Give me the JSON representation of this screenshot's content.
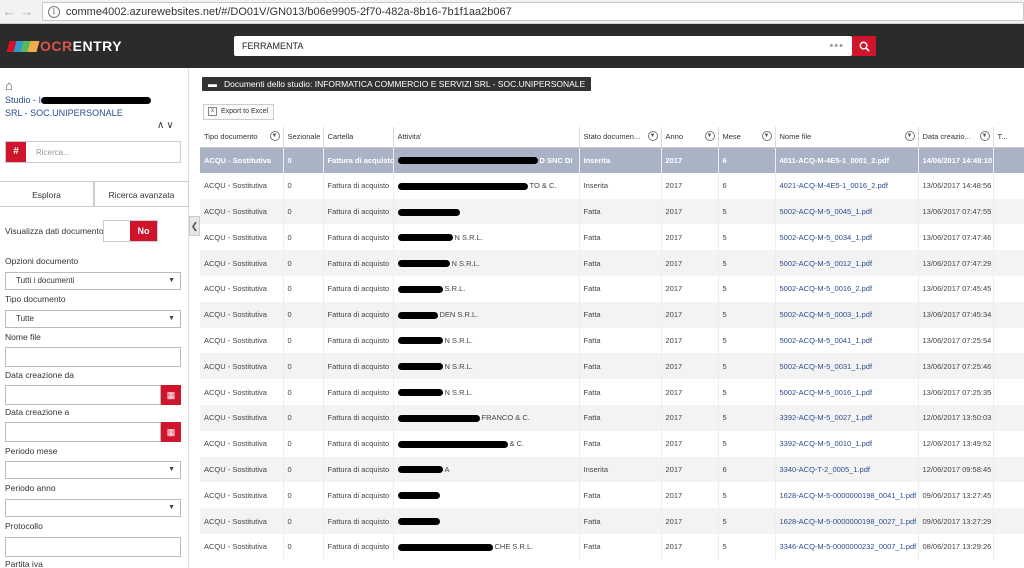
{
  "browser": {
    "url": "comme4002.azurewebsites.net/#/DO01V/GN013/b06e9905-2f70-482a-8b16-7b1f1aa2b067",
    "back": "←",
    "forward": "→"
  },
  "header": {
    "logo_prefix": "OCR",
    "logo_suffix": "ENTRY",
    "search_value": "FERRAMENTA",
    "search_dots": "•••",
    "logo_colors": [
      "#d0142b",
      "#2e9ad0",
      "#5cb85c",
      "#f0ad4e"
    ]
  },
  "sidebar": {
    "studio_prefix": "Studio - I",
    "studio_line2": "SRL - SOC.UNIPERSONALE",
    "search_hash": "#",
    "search_placeholder": "Ricerca...",
    "tabs": [
      "Esplora",
      "Ricerca avanzata"
    ],
    "visualizza_label": "Visualizza dati documento",
    "toggle_value": "No",
    "opzioni_label": "Opzioni documento",
    "opzioni_value": "Tutti i documenti",
    "tipo_label": "Tipo documento",
    "tipo_value": "Tutte",
    "nome_file_label": "Nome file",
    "data_da_label": "Data creazione da",
    "data_a_label": "Data creazione a",
    "periodo_mese_label": "Periodo mese",
    "periodo_anno_label": "Periodo anno",
    "protocollo_label": "Protocollo",
    "partita_label": "Partita iva"
  },
  "main": {
    "title": "Documenti dello studio: INFORMATICA COMMERCIO E SERVIZI SRL - SOC.UNIPERSONALE",
    "export_label": "Export to Excel",
    "columns": [
      "Tipo documento",
      "Sezionale",
      "Cartella",
      "Attivita'",
      "Stato documen...",
      "Anno",
      "Mese",
      "Nome file",
      "Data creazio...",
      "T..."
    ],
    "rows": [
      [
        "ACQU - Sostitutiva",
        "0",
        "Fattura di acquisto",
        "D SNC DI",
        "Inserita",
        "2017",
        "6",
        "4011-ACQ-M-4E5-1_0001_2.pdf",
        "14/06/2017 14:48:10"
      ],
      [
        "ACQU - Sostitutiva",
        "0",
        "Fattura di acquisto",
        "TO & C.",
        "Inserita",
        "2017",
        "6",
        "4021-ACQ-M-4E5-1_0016_2.pdf",
        "13/06/2017 14:48:56"
      ],
      [
        "ACQU - Sostitutiva",
        "0",
        "Fattura di acquisto",
        "",
        "Fatta",
        "2017",
        "5",
        "5002-ACQ-M-5_0045_1.pdf",
        "13/06/2017 07:47:55"
      ],
      [
        "ACQU - Sostitutiva",
        "0",
        "Fattura di acquisto",
        "N S.R.L.",
        "Fatta",
        "2017",
        "5",
        "5002-ACQ-M-5_0034_1.pdf",
        "13/06/2017 07:47:46"
      ],
      [
        "ACQU - Sostitutiva",
        "0",
        "Fattura di acquisto",
        "N S.R.L.",
        "Fatta",
        "2017",
        "5",
        "5002-ACQ-M-5_0012_1.pdf",
        "13/06/2017 07:47:29"
      ],
      [
        "ACQU - Sostitutiva",
        "0",
        "Fattura di acquisto",
        "S.R.L.",
        "Fatta",
        "2017",
        "5",
        "5002-ACQ-M-5_0016_2.pdf",
        "13/06/2017 07:45:45"
      ],
      [
        "ACQU - Sostitutiva",
        "0",
        "Fattura di acquisto",
        "DEN S.R.L.",
        "Fatta",
        "2017",
        "5",
        "5002-ACQ-M-5_0003_1.pdf",
        "13/06/2017 07:45:34"
      ],
      [
        "ACQU - Sostitutiva",
        "0",
        "Fattura di acquisto",
        "N S.R.L.",
        "Fatta",
        "2017",
        "5",
        "5002-ACQ-M-5_0041_1.pdf",
        "13/06/2017 07:25:54"
      ],
      [
        "ACQU - Sostitutiva",
        "0",
        "Fattura di acquisto",
        "N S.R.L.",
        "Fatta",
        "2017",
        "5",
        "5002-ACQ-M-5_0031_1.pdf",
        "13/06/2017 07:25:46"
      ],
      [
        "ACQU - Sostitutiva",
        "0",
        "Fattura di acquisto",
        "N S.R.L.",
        "Fatta",
        "2017",
        "5",
        "5002-ACQ-M-5_0016_1.pdf",
        "13/06/2017 07:25:35"
      ],
      [
        "ACQU - Sostitutiva",
        "0",
        "Fattura di acquisto",
        "FRANCO & C.",
        "Fatta",
        "2017",
        "5",
        "3392-ACQ-M-5_0027_1.pdf",
        "12/06/2017 13:50:03"
      ],
      [
        "ACQU - Sostitutiva",
        "0",
        "Fattura di acquisto",
        "& C.",
        "Fatta",
        "2017",
        "5",
        "3392-ACQ-M-5_0010_1.pdf",
        "12/06/2017 13:49:52"
      ],
      [
        "ACQU - Sostitutiva",
        "0",
        "Fattura di acquisto",
        "A",
        "Inserita",
        "2017",
        "6",
        "3340-ACQ-T-2_0005_1.pdf",
        "12/06/2017 09:58:45"
      ],
      [
        "ACQU - Sostitutiva",
        "0",
        "Fattura di acquisto",
        "",
        "Fatta",
        "2017",
        "5",
        "1628-ACQ-M-5-0000000198_0041_1.pdf",
        "09/06/2017 13:27:45"
      ],
      [
        "ACQU - Sostitutiva",
        "0",
        "Fattura di acquisto",
        "",
        "Fatta",
        "2017",
        "5",
        "1628-ACQ-M-5-0000000198_0027_1.pdf",
        "09/06/2017 13:27:29"
      ],
      [
        "ACQU - Sostitutiva",
        "0",
        "Fattura di acquisto",
        "CHE S.R.L.",
        "Fatta",
        "2017",
        "5",
        "3346-ACQ-M-5-0000000232_0007_1.pdf",
        "08/06/2017 13:29:26"
      ]
    ]
  }
}
